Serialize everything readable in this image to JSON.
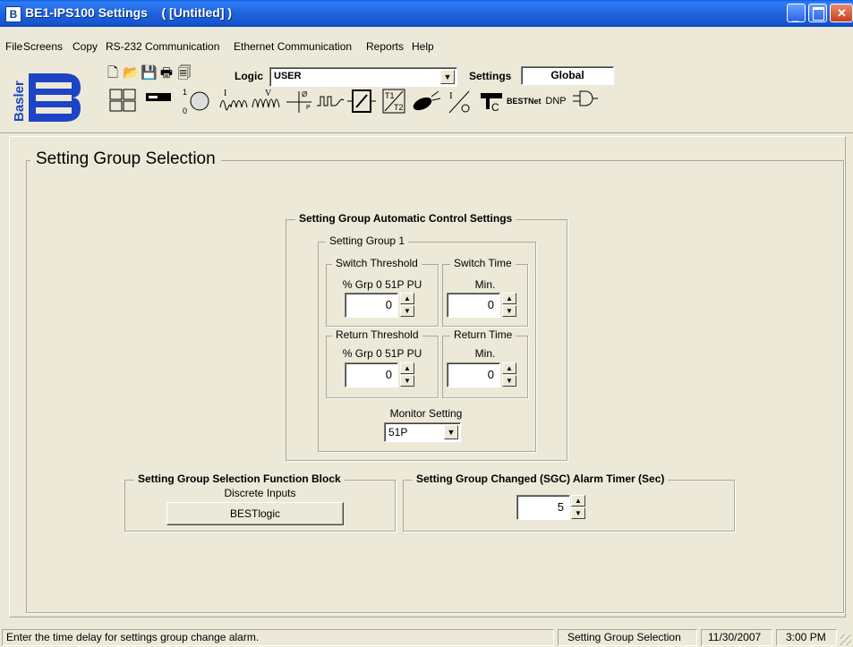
{
  "window": {
    "title": "BE1-IPS100 Settings    ( [Untitled] )"
  },
  "menu": [
    "File",
    "Screens",
    "Copy",
    "RS-232 Communication",
    "Ethernet Communication",
    "Reports",
    "Help"
  ],
  "toolbar": {
    "logic_label": "Logic",
    "logic_value": "USER",
    "settings_label": "Settings",
    "settings_value": "Global",
    "logo_text": "Basler",
    "bestnet_label": "BESTNet",
    "dnp_label": "DNP"
  },
  "page": {
    "title": "Setting Group Selection",
    "auto_control": {
      "title": "Setting Group Automatic Control Settings",
      "group1_label": "Setting Group 1",
      "switch_threshold": {
        "title": "Switch Threshold",
        "unit": "% Grp 0 51P PU",
        "value": "0"
      },
      "switch_time": {
        "title": "Switch Time",
        "unit": "Min.",
        "value": "0"
      },
      "return_threshold": {
        "title": "Return Threshold",
        "unit": "% Grp 0 51P PU",
        "value": "0"
      },
      "return_time": {
        "title": "Return Time",
        "unit": "Min.",
        "value": "0"
      },
      "monitor_label": "Monitor Setting",
      "monitor_value": "51P"
    },
    "function_block": {
      "title": "Setting Group Selection Function Block",
      "subtitle": "Discrete Inputs",
      "button_label": "BESTlogic"
    },
    "alarm_timer": {
      "title": "Setting Group Changed (SGC) Alarm Timer (Sec)",
      "value": "5"
    }
  },
  "status": {
    "message": "Enter the time delay for settings group change alarm.",
    "screen": "Setting Group Selection",
    "date": "11/30/2007",
    "time": "3:00 PM"
  },
  "colors": {
    "titlebar": "#245edb",
    "face": "#ece9d8",
    "logo_blue": "#1c44c4"
  }
}
